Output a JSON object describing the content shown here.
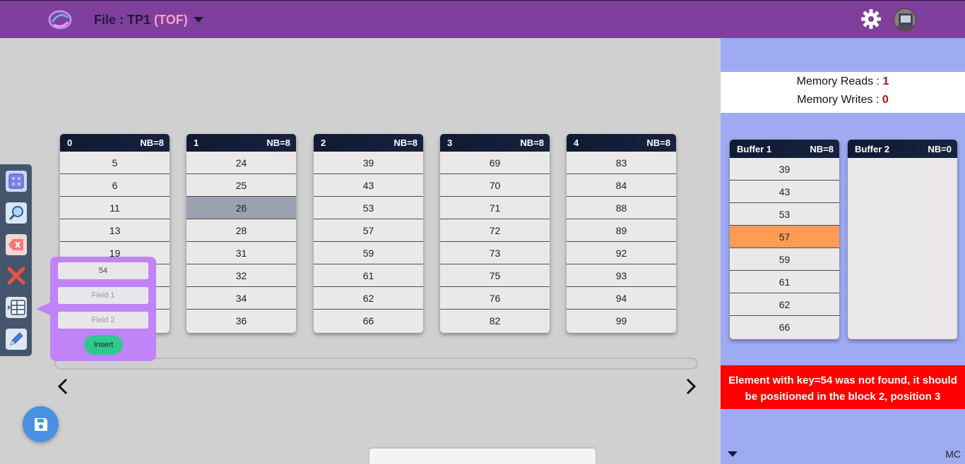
{
  "header": {
    "file_label": "File : TP1",
    "file_type": "(TOF)"
  },
  "blocks": [
    {
      "index": "0",
      "nb": "NB=8",
      "values": [
        "5",
        "6",
        "11",
        "13",
        "19",
        "",
        "",
        ""
      ]
    },
    {
      "index": "1",
      "nb": "NB=8",
      "values": [
        "24",
        "25",
        "26",
        "28",
        "31",
        "32",
        "34",
        "36"
      ]
    },
    {
      "index": "2",
      "nb": "NB=8",
      "values": [
        "39",
        "43",
        "53",
        "57",
        "59",
        "61",
        "62",
        "66"
      ]
    },
    {
      "index": "3",
      "nb": "NB=8",
      "values": [
        "69",
        "70",
        "71",
        "72",
        "73",
        "75",
        "76",
        "82"
      ]
    },
    {
      "index": "4",
      "nb": "NB=8",
      "values": [
        "83",
        "84",
        "88",
        "89",
        "92",
        "93",
        "94",
        "99"
      ]
    }
  ],
  "highlighted": {
    "block": 1,
    "row": 2
  },
  "insert_form": {
    "key_value": "54",
    "field1_placeholder": "Field 1",
    "field2_placeholder": "Field 2",
    "insert_label": "Insert"
  },
  "toolbar": [
    "grid-icon",
    "search-icon",
    "erase-icon",
    "delete-icon",
    "table-insert-icon",
    "edit-icon"
  ],
  "stats": {
    "reads_label": "Memory Reads :",
    "reads_value": "1",
    "writes_label": "Memory Writes :",
    "writes_value": "0"
  },
  "buffers": [
    {
      "name": "Buffer 1",
      "nb": "NB=8",
      "values": [
        "39",
        "43",
        "53",
        "57",
        "59",
        "61",
        "62",
        "66"
      ],
      "highlight_row": 3
    },
    {
      "name": "Buffer 2",
      "nb": "NB=0",
      "values": []
    }
  ],
  "message": "Element with key=54 was not found, it should be positioned in the block 2, position 3",
  "footer_tag": "MC",
  "colors": {
    "topbar": "#7e3f9d",
    "right_panel": "#9eaaf2",
    "error": "#fe0000",
    "highlight_gray": "#9aa2b2",
    "highlight_orange": "#ff9c52",
    "insert_button": "#2fc98f",
    "popover": "#c083f8"
  }
}
